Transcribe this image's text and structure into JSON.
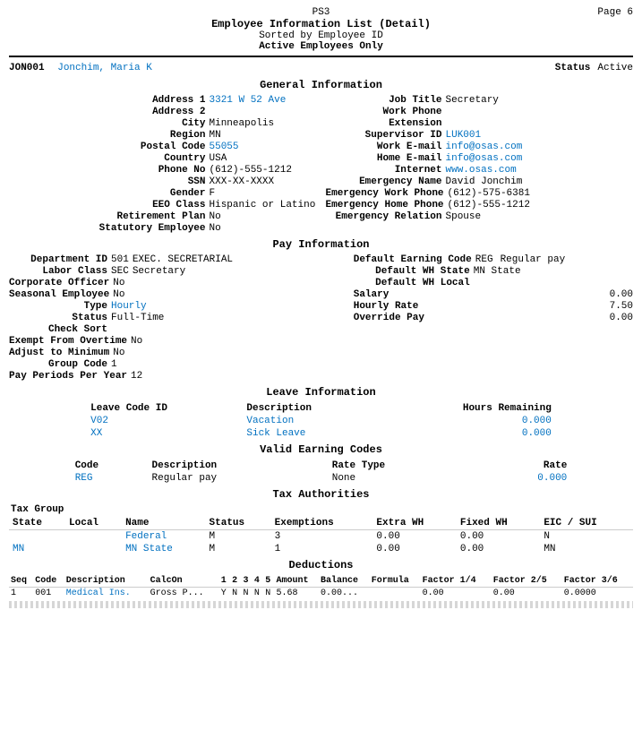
{
  "header": {
    "report_id": "PS3",
    "page_label": "Page 6",
    "title1": "Employee Information List (Detail)",
    "title2": "Sorted by Employee ID",
    "title3": "Active Employees Only"
  },
  "employee": {
    "id": "JON001",
    "name": "Jonchim, Maria K",
    "status_label": "Status",
    "status_value": "Active"
  },
  "general_info": {
    "section_title": "General Information",
    "left": {
      "address1_label": "Address 1",
      "address1_value": "3321 W 52 Ave",
      "address2_label": "Address 2",
      "address2_value": "",
      "city_label": "City",
      "city_value": "Minneapolis",
      "region_label": "Region",
      "region_value": "MN",
      "postal_label": "Postal Code",
      "postal_value": "55055",
      "country_label": "Country",
      "country_value": "USA",
      "phone_label": "Phone No",
      "phone_value": "(612)-555-1212",
      "ssn_label": "SSN",
      "ssn_value": "XXX-XX-XXXX",
      "gender_label": "Gender",
      "gender_value": "F",
      "eeo_label": "EEO Class",
      "eeo_value": "Hispanic or Latino",
      "retirement_label": "Retirement Plan",
      "retirement_value": "No",
      "statutory_label": "Statutory Employee",
      "statutory_value": "No"
    },
    "right": {
      "jobtitle_label": "Job Title",
      "jobtitle_value": "Secretary",
      "workphone_label": "Work Phone",
      "workphone_value": "",
      "extension_label": "Extension",
      "extension_value": "",
      "supervisor_label": "Supervisor ID",
      "supervisor_value": "LUK001",
      "workemail_label": "Work E-mail",
      "workemail_value": "info@osas.com",
      "homeemail_label": "Home E-mail",
      "homeemail_value": "info@osas.com",
      "internet_label": "Internet",
      "internet_value": "www.osas.com",
      "emergency_label": "Emergency Name",
      "emergency_value": "David Jonchim",
      "emerg_work_label": "Emergency Work Phone",
      "emerg_work_value": "(612)-575-6381",
      "emerg_home_label": "Emergency Home Phone",
      "emerg_home_value": "(612)-555-1212",
      "emerg_rel_label": "Emergency Relation",
      "emerg_rel_value": "Spouse"
    }
  },
  "pay_info": {
    "section_title": "Pay Information",
    "left": {
      "dept_label": "Department ID",
      "dept_value": "501",
      "dept_name": "EXEC. SECRETARIAL",
      "labor_label": "Labor Class",
      "labor_value": "SEC",
      "labor_name": "Secretary",
      "corp_label": "Corporate Officer",
      "corp_value": "No",
      "seasonal_label": "Seasonal Employee",
      "seasonal_value": "No",
      "type_label": "Type",
      "type_value": "Hourly",
      "status_label": "Status",
      "status_value": "Full-Time",
      "checksort_label": "Check Sort",
      "checksort_value": "",
      "exempt_label": "Exempt From Overtime",
      "exempt_value": "No",
      "adjust_label": "Adjust to Minimum",
      "adjust_value": "No",
      "groupcode_label": "Group Code",
      "groupcode_value": "1",
      "payperiods_label": "Pay Periods Per Year",
      "payperiods_value": "12"
    },
    "right": {
      "default_earn_label": "Default Earning Code",
      "default_earn_value": "REG",
      "default_earn_desc": "Regular pay",
      "default_wh_label": "Default WH State",
      "default_wh_value": "MN State",
      "default_wh_local_label": "Default WH Local",
      "default_wh_local_value": "",
      "salary_label": "Salary",
      "salary_value": "0.00",
      "hourly_label": "Hourly Rate",
      "hourly_value": "7.50",
      "override_label": "Override Pay",
      "override_value": "0.00"
    }
  },
  "leave_info": {
    "section_title": "Leave Information",
    "headers": [
      "Leave Code ID",
      "Description",
      "Hours Remaining"
    ],
    "rows": [
      {
        "code": "V02",
        "description": "Vacation",
        "hours": "0.000"
      },
      {
        "code": "XX",
        "description": "Sick Leave",
        "hours": "0.000"
      }
    ]
  },
  "earning_codes": {
    "section_title": "Valid Earning Codes",
    "headers": [
      "Code",
      "Description",
      "Rate Type",
      "Rate"
    ],
    "rows": [
      {
        "code": "REG",
        "description": "Regular pay",
        "rate_type": "None",
        "rate": "0.000"
      }
    ]
  },
  "tax_authorities": {
    "section_title": "Tax Authorities",
    "group_label": "Tax Group",
    "headers": [
      "State",
      "Local",
      "Name",
      "Status",
      "Exemptions",
      "Extra WH",
      "Fixed WH",
      "EIC / SUI"
    ],
    "rows": [
      {
        "state": "",
        "local": "",
        "name": "Federal",
        "status": "M",
        "exemptions": "3",
        "extra_wh": "0.00",
        "fixed_wh": "0.00",
        "eic_sui": "N"
      },
      {
        "state": "MN",
        "local": "",
        "name": "MN State",
        "status": "M",
        "exemptions": "1",
        "extra_wh": "0.00",
        "fixed_wh": "0.00",
        "eic_sui": "MN"
      }
    ]
  },
  "deductions": {
    "section_title": "Deductions",
    "headers": [
      "Seq",
      "Code",
      "Description",
      "CalcOn",
      "1",
      "2",
      "3",
      "4",
      "5",
      "Amount",
      "Balance",
      "Formula",
      "Factor 1/4",
      "Factor 2/5",
      "Factor 3/6"
    ],
    "rows": [
      {
        "seq": "1",
        "code": "001",
        "description": "Medical Ins.",
        "calcon": "Gross P...",
        "c1": "Y",
        "c2": "N",
        "c3": "N",
        "c4": "N",
        "c5": "N",
        "amount": "5.68",
        "balance": "0.00...",
        "formula": "",
        "f14": "0.00",
        "f25": "0.00",
        "f36": "0.0000"
      }
    ]
  }
}
